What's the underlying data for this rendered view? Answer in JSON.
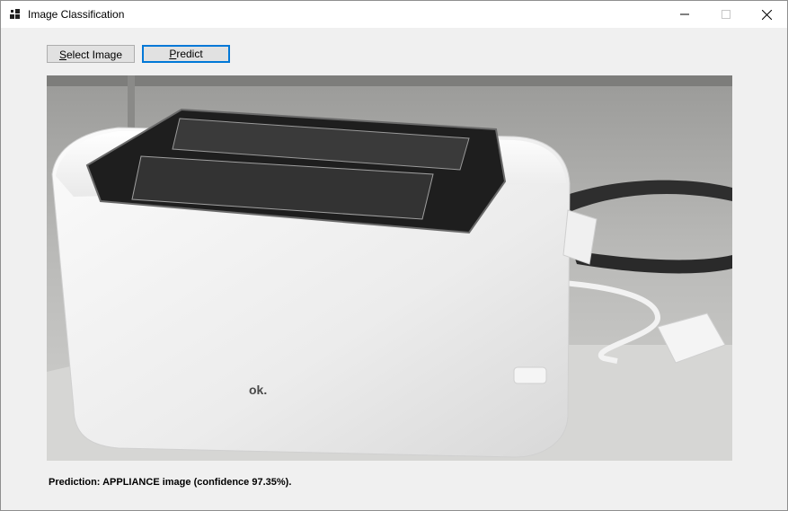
{
  "window": {
    "title": "Image Classification"
  },
  "toolbar": {
    "select_image": {
      "mnemonic": "S",
      "rest": "elect Image"
    },
    "predict": {
      "mnemonic": "P",
      "rest": "redict"
    }
  },
  "picture": {
    "logo_text": "ok."
  },
  "result": {
    "prediction_text": "Prediction: APPLIANCE image (confidence 97.35%)."
  },
  "colors": {
    "focus_border": "#0078d7",
    "window_background": "#f0f0f0",
    "button_face": "#e1e1e1"
  },
  "icons": [
    "app-icon",
    "minimize-icon",
    "maximize-icon",
    "close-icon"
  ]
}
